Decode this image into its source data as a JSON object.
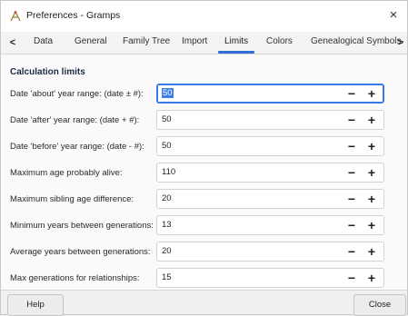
{
  "window": {
    "title": "Preferences - Gramps",
    "close_glyph": "×"
  },
  "tabs": {
    "prev_glyph": "<",
    "next_glyph": ">",
    "items": [
      {
        "label": "Data"
      },
      {
        "label": "General"
      },
      {
        "label": "Family Tree"
      },
      {
        "label": "Import"
      },
      {
        "label": "Limits"
      },
      {
        "label": "Colors"
      },
      {
        "label": "Genealogical Symbols"
      }
    ],
    "active": "Limits",
    "accent_color": "#2f6fd6"
  },
  "section": {
    "title": "Calculation limits"
  },
  "rows": [
    {
      "label": "Date 'about' year range: (date ± #):",
      "value": "50"
    },
    {
      "label": "Date 'after' year range:  (date + #):",
      "value": "50"
    },
    {
      "label": "Date 'before' year range: (date - #):",
      "value": "50"
    },
    {
      "label": "Maximum age probably alive:",
      "value": "110"
    },
    {
      "label": "Maximum sibling age difference:",
      "value": "20"
    },
    {
      "label": "Minimum years between generations:",
      "value": "13"
    },
    {
      "label": "Average years between generations:",
      "value": "20"
    },
    {
      "label": "Max generations for relationships:",
      "value": "15"
    }
  ],
  "spin_glyphs": {
    "minus": "−",
    "plus": "+"
  },
  "footer": {
    "help_label": "Help",
    "close_label": "Close"
  },
  "icons": {
    "app": "gramps-app-icon",
    "close": "close-icon"
  }
}
